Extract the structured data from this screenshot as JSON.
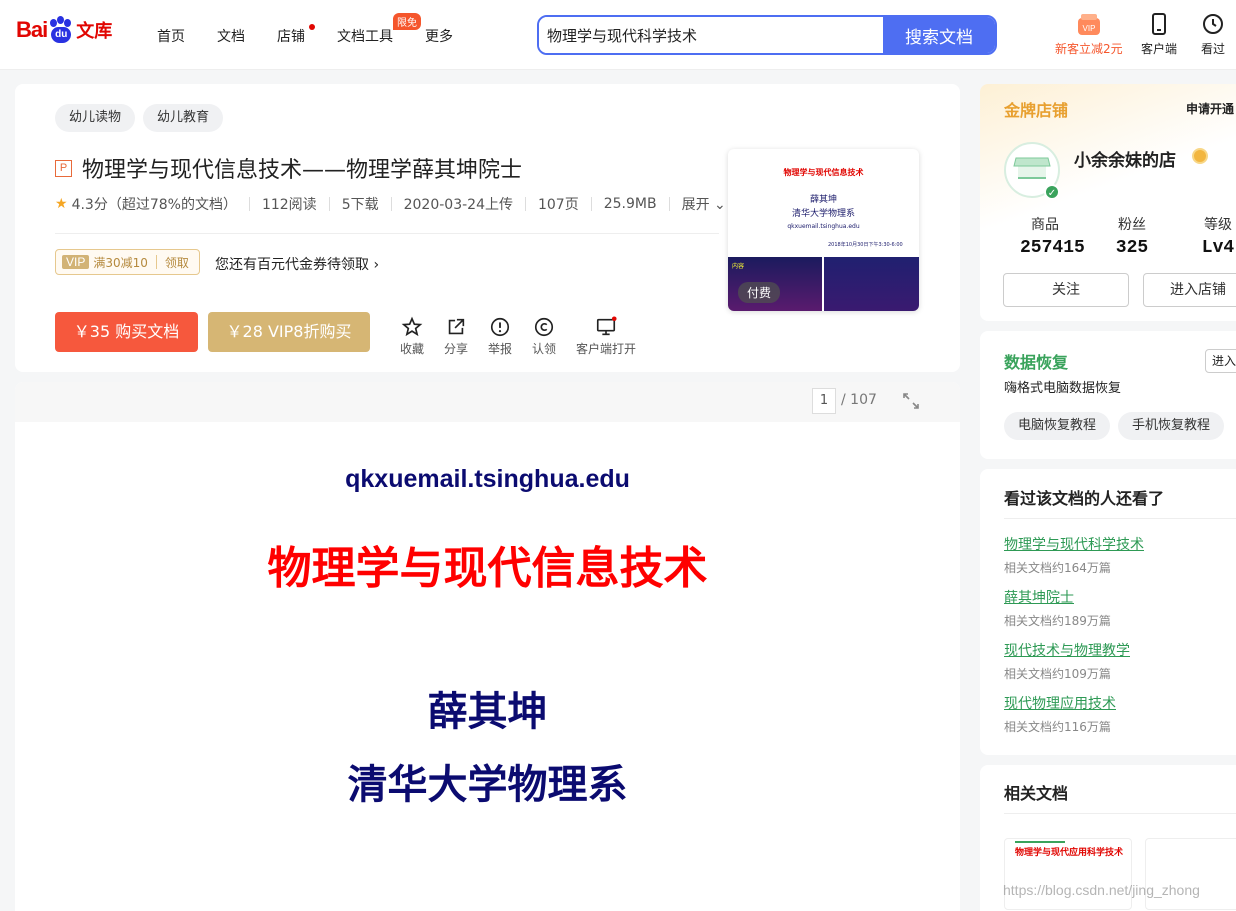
{
  "header": {
    "logo_left": "Bai",
    "logo_paw": "du",
    "logo_right": "文库",
    "nav": [
      {
        "label": "首页"
      },
      {
        "label": "文档"
      },
      {
        "label": "店铺"
      },
      {
        "label": "文档工具",
        "badge": "限免"
      },
      {
        "label": "更多"
      }
    ],
    "search": {
      "value": "物理学与现代科学技术",
      "button": "搜索文档"
    },
    "icons": [
      {
        "label": "新客立减2元",
        "icon": "vip-gift-icon",
        "color": "#f5562c"
      },
      {
        "label": "客户端",
        "icon": "phone-icon"
      },
      {
        "label": "看过",
        "icon": "clock-icon"
      }
    ]
  },
  "doc": {
    "tags": [
      "幼儿读物",
      "幼儿教育"
    ],
    "type_icon": "P",
    "title": "物理学与现代信息技术——物理学薛其坤院士",
    "rating": "4.3分（超过78%的文档）",
    "reads": "112阅读",
    "downloads": "5下载",
    "upload_date": "2020-03-24上传",
    "pages": "107页",
    "size": "25.9MB",
    "expand": "展开",
    "coupon": {
      "vip": "VIP",
      "text": "满30减10",
      "claim": "领取"
    },
    "coupon_tip": "您还有百元代金券待领取",
    "buy_button": "￥35 购买文档",
    "vip_button": "￥28 VIP8折购买",
    "actions": [
      "收藏",
      "分享",
      "举报",
      "认领",
      "客户端打开"
    ],
    "thumbnail": {
      "title": "物理学与现代信息技术",
      "author": "薛其坤",
      "dept": "清华大学物理系",
      "email": "qkxuemail.tsinghua.edu",
      "date": "2018年10月30日下午3:30-6:00",
      "section": "内容",
      "paid_label": "付费"
    }
  },
  "reader": {
    "current_page": "1",
    "total_pages": "/ 107",
    "page_title": "物理学与现代信息技术",
    "page_author": "薛其坤",
    "page_dept": "清华大学物理系",
    "page_email": "qkxuemail.tsinghua.edu"
  },
  "shop": {
    "header": "金牌店铺",
    "apply": "申请开通",
    "name": "小余余妹的店",
    "stats": [
      {
        "label": "商品",
        "value": "257415"
      },
      {
        "label": "粉丝",
        "value": "325"
      },
      {
        "label": "等级",
        "value": "Lv4"
      }
    ],
    "follow": "关注",
    "enter": "进入店铺"
  },
  "recovery": {
    "title": "数据恢复",
    "desc": "嗨格式电脑数据恢复",
    "enter": "进入",
    "pills": [
      "电脑恢复教程",
      "手机恢复教程"
    ]
  },
  "also_viewed": {
    "title": "看过该文档的人还看了",
    "items": [
      {
        "title": "物理学与现代科学技术",
        "sub": "相关文档约164万篇"
      },
      {
        "title": "薛其坤院士",
        "sub": "相关文档约189万篇"
      },
      {
        "title": "现代技术与物理教学",
        "sub": "相关文档约109万篇"
      },
      {
        "title": "现代物理应用技术",
        "sub": "相关文档约116万篇"
      }
    ]
  },
  "related": {
    "title": "相关文档",
    "thumb_title": "物理学与现代应用科学技术"
  },
  "watermark": "https://blog.csdn.net/jing_zhong"
}
